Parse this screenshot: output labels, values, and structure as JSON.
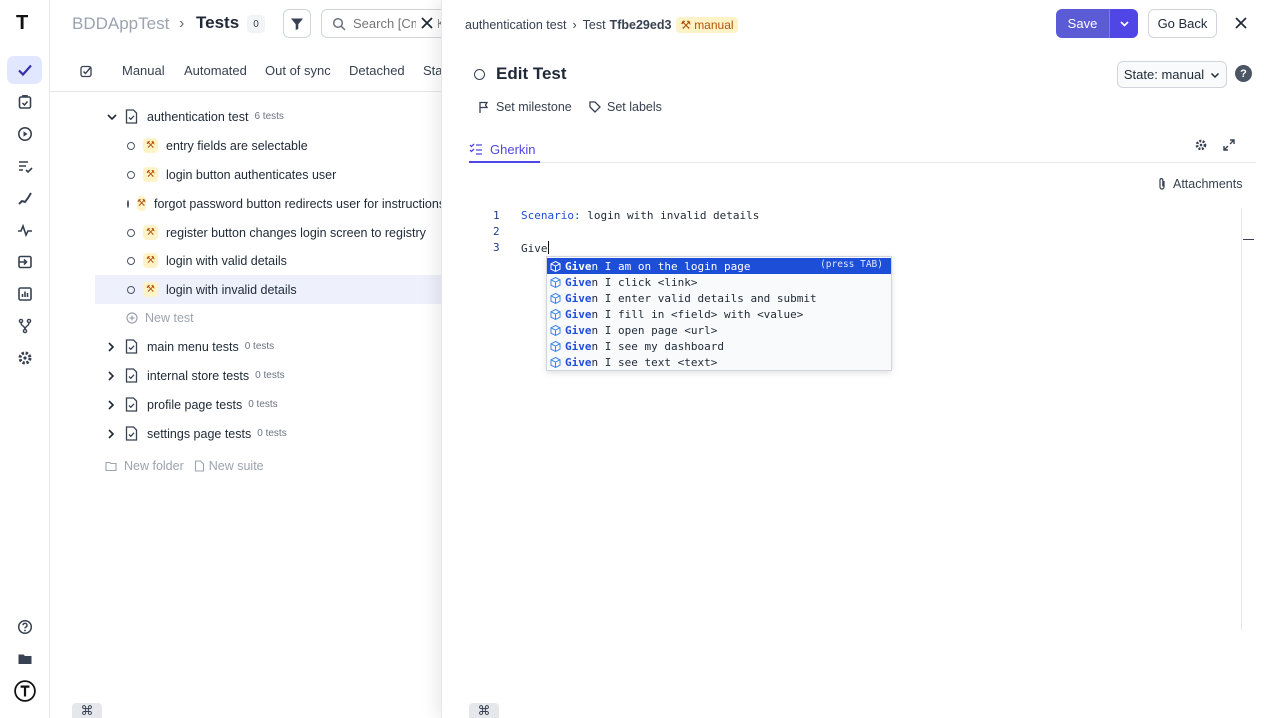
{
  "rail": {
    "logo": "T",
    "icons": [
      "tests-check-icon",
      "clipboard-icon",
      "play-icon",
      "list-check-icon",
      "steps-icon",
      "pulse-icon",
      "import-icon",
      "chart-icon",
      "branch-icon",
      "gear-icon"
    ],
    "bottom_icons": [
      "help-icon",
      "folder-icon",
      "testomat-logo-icon"
    ]
  },
  "header": {
    "project": "BDDAppTest",
    "separator": "›",
    "title": "Tests",
    "count": "0",
    "search_placeholder": "Search [Cmd+K]"
  },
  "tabs": [
    "Manual",
    "Automated",
    "Out of sync",
    "Detached",
    "Sta"
  ],
  "tree": {
    "suite": {
      "label": "authentication test",
      "count": "6 tests"
    },
    "tests": [
      {
        "label": "entry fields are selectable"
      },
      {
        "label": "login button authenticates user"
      },
      {
        "label": "forgot password button redirects user for instructions"
      },
      {
        "label": "register button changes login screen to registry"
      },
      {
        "label": "login with valid details"
      },
      {
        "label": "login with invalid details",
        "selected": true
      }
    ],
    "new_test": "New test",
    "other_suites": [
      {
        "label": "main menu tests",
        "count": "0 tests"
      },
      {
        "label": "internal store tests",
        "count": "0 tests"
      },
      {
        "label": "profile page tests",
        "count": "0 tests"
      },
      {
        "label": "settings page tests",
        "count": "0 tests"
      }
    ],
    "new_folder": "New folder",
    "new_suite": "New suite"
  },
  "editor": {
    "breadcrumb_suite": "authentication test",
    "breadcrumb_sep": "›",
    "breadcrumb_test_prefix": "Test",
    "breadcrumb_test_id": "Tfbe29ed3",
    "manual_badge": "manual",
    "save_label": "Save",
    "go_back_label": "Go Back",
    "title": "Edit Test",
    "state_label": "State: manual",
    "set_milestone": "Set milestone",
    "set_labels": "Set labels",
    "tab_gherkin": "Gherkin",
    "attachments": "Attachments",
    "code_lines": [
      {
        "num": "1",
        "keyword": "Scenario:",
        "text": " login with invalid details"
      },
      {
        "num": "2",
        "keyword": "",
        "text": ""
      },
      {
        "num": "3",
        "keyword": "",
        "text": "Give"
      }
    ],
    "autocomplete": {
      "hint": "(press TAB)",
      "items": [
        {
          "match": "Give",
          "rest": "n I am on the login page"
        },
        {
          "match": "Give",
          "rest": "n I click <link>"
        },
        {
          "match": "Give",
          "rest": "n I enter valid details and submit"
        },
        {
          "match": "Give",
          "rest": "n I fill in <field> with <value>"
        },
        {
          "match": "Give",
          "rest": "n I open page <url>"
        },
        {
          "match": "Give",
          "rest": "n I see my dashboard"
        },
        {
          "match": "Give",
          "rest": "n I see text <text>"
        }
      ]
    }
  },
  "kbd_symbol": "⌘",
  "colors": {
    "accent": "#4f46e5",
    "manual_bg": "#fef3c7",
    "manual_fg": "#b45309",
    "selected_row": "#eef0fb"
  }
}
